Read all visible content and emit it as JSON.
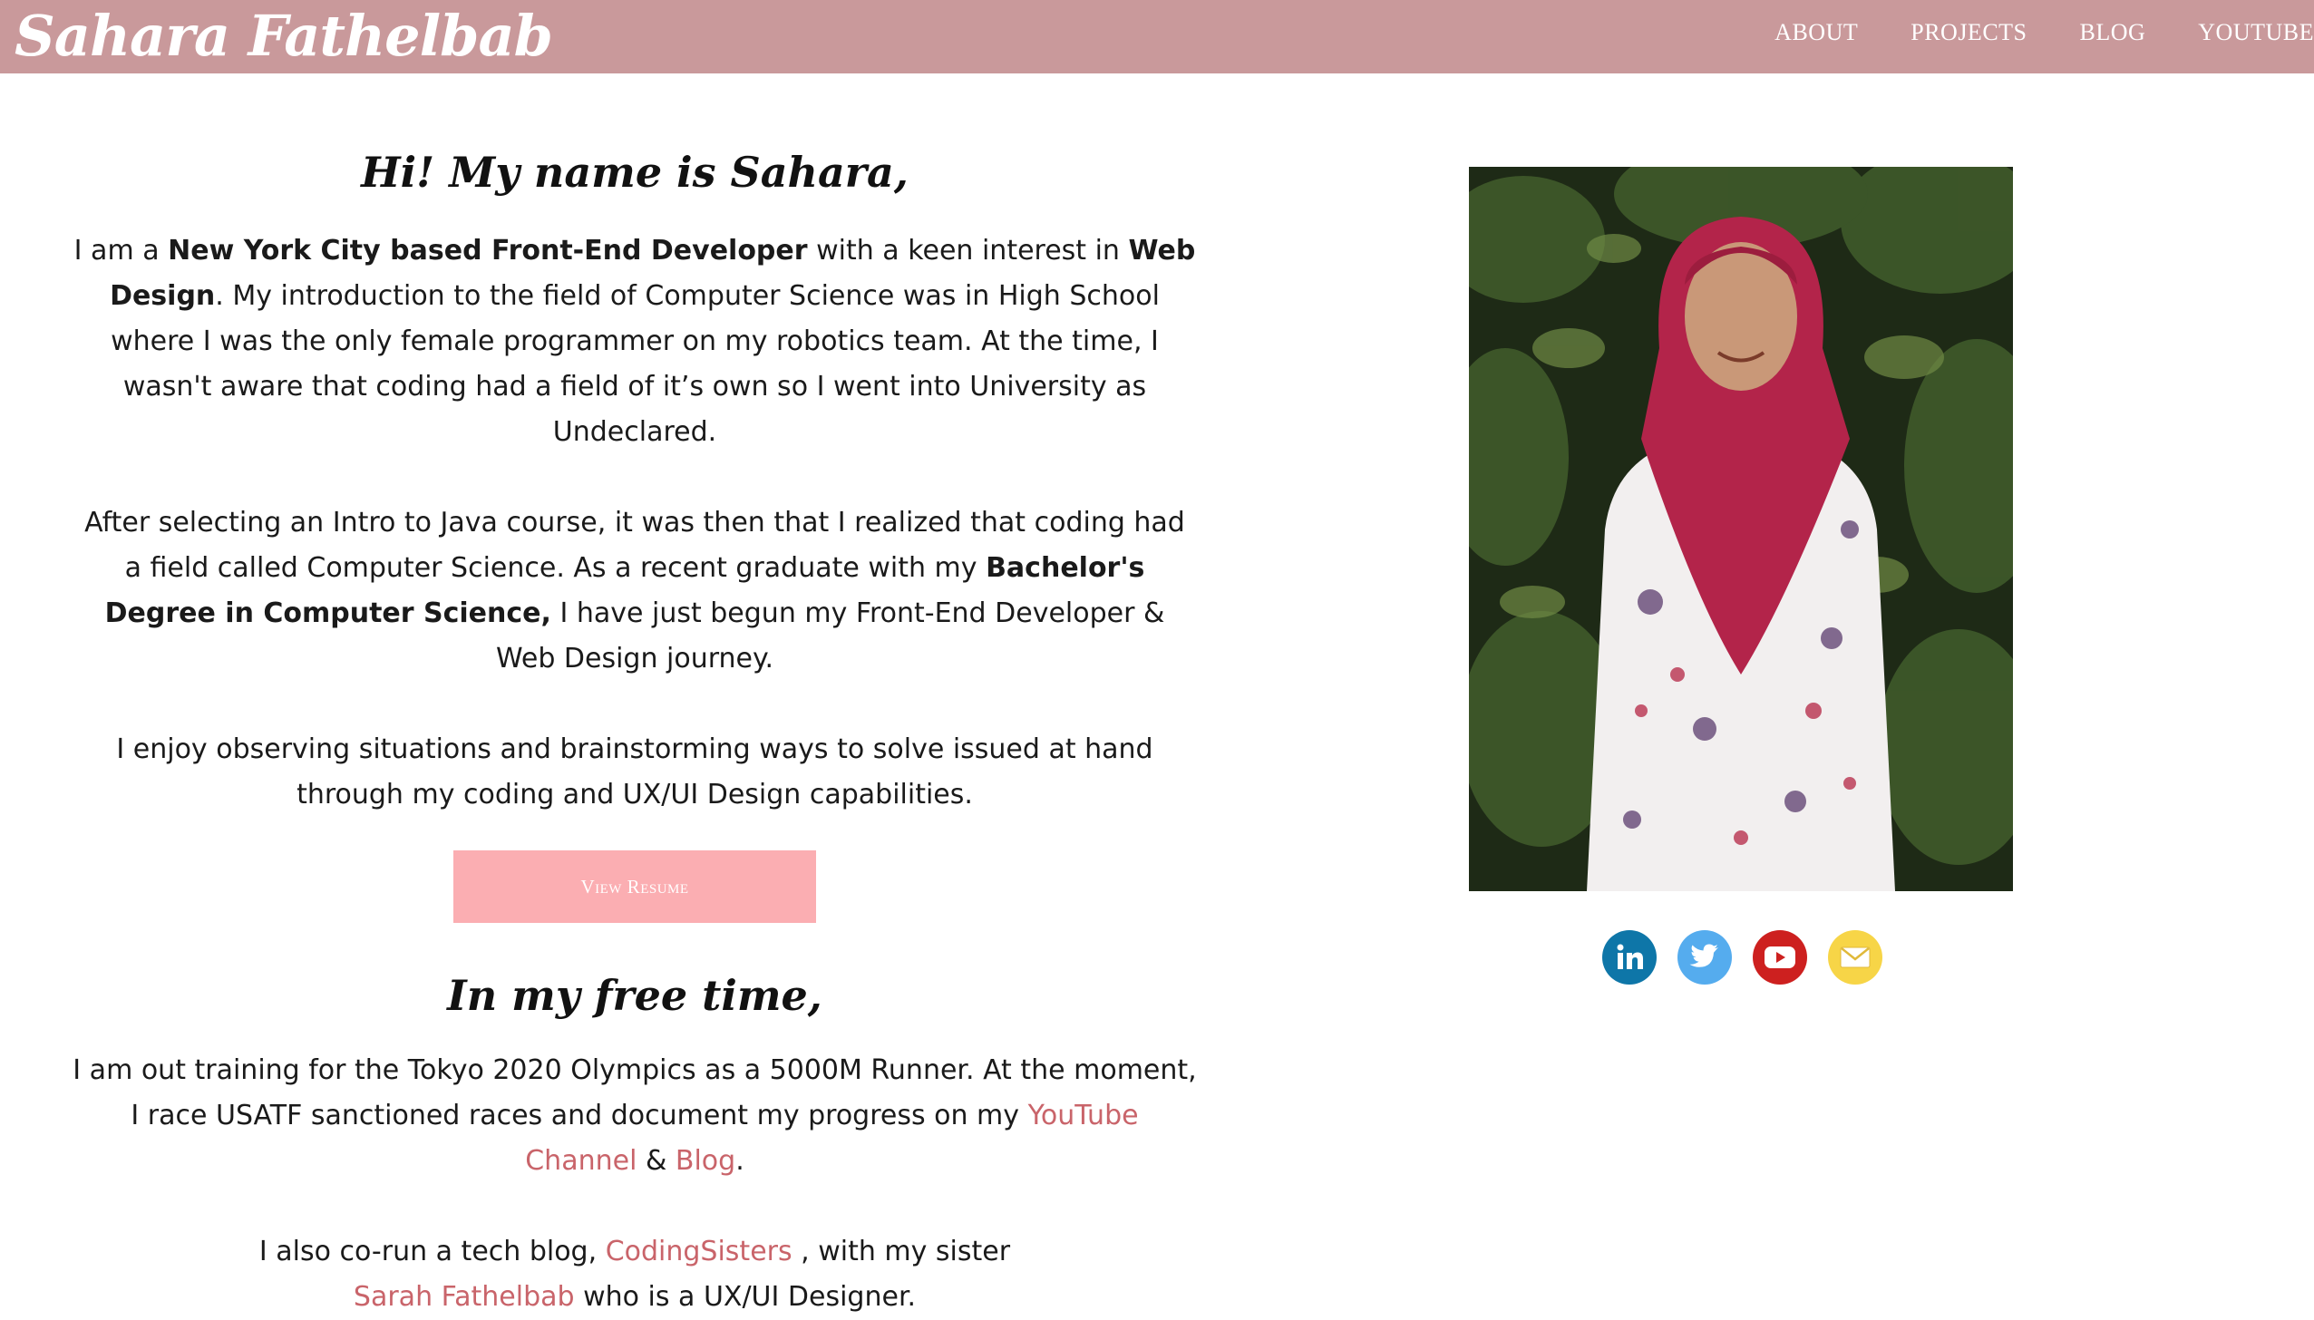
{
  "brand": "Sahara Fathelbab",
  "nav": [
    "ABOUT",
    "PROJECTS",
    "BLOG",
    "YOUTUBE"
  ],
  "about": {
    "greeting": "Hi! My name is Sahara,",
    "p1": {
      "a": "I am a ",
      "b": "New York City based Front-End Developer",
      "c": " with a keen interest in ",
      "d": "Web Design",
      "e": ". My introduction to the field of Computer Science was in High School where I was the only female programmer on my robotics team. At the time, I wasn't aware that coding had a field of it’s own so I went into University as Undeclared."
    },
    "p2": {
      "a": "After selecting an Intro to Java course, it was then that I realized that coding had a field called Computer Science. As a recent graduate with my ",
      "b": "Bachelor's Degree in Computer Science,",
      "c": " I have just begun my Front-End Developer & Web Design journey."
    },
    "p3": "I enjoy observing situations and brainstorming ways to solve issued at hand through my coding and UX/UI Design capabilities.",
    "resume_button": "View Resume"
  },
  "free_time": {
    "heading": "In my free time,",
    "p1": {
      "a": "I am out training for the Tokyo 2020 Olympics as a 5000M Runner. At the moment, I race USATF sanctioned races and document my progress on my ",
      "youtube_link": "YouTube Channel",
      "and": " & ",
      "blog_link": "Blog",
      "end": "."
    },
    "p2": {
      "a": "I also co-run a tech blog, ",
      "coding_link": "CodingSisters",
      "b": " , with my sister",
      "sister_link": "Sarah Fathelbab",
      "c": " who is a UX/UI Designer."
    }
  },
  "social_icons": [
    {
      "name": "linkedin-icon",
      "color": "#0e76a8"
    },
    {
      "name": "twitter-icon",
      "color": "#55acee"
    },
    {
      "name": "youtube-icon",
      "color": "#cd201f"
    },
    {
      "name": "email-icon",
      "color": "#f7d547"
    }
  ],
  "colors": {
    "header": "#c9999b",
    "button": "#fbaeb2",
    "link": "#c9646a"
  }
}
